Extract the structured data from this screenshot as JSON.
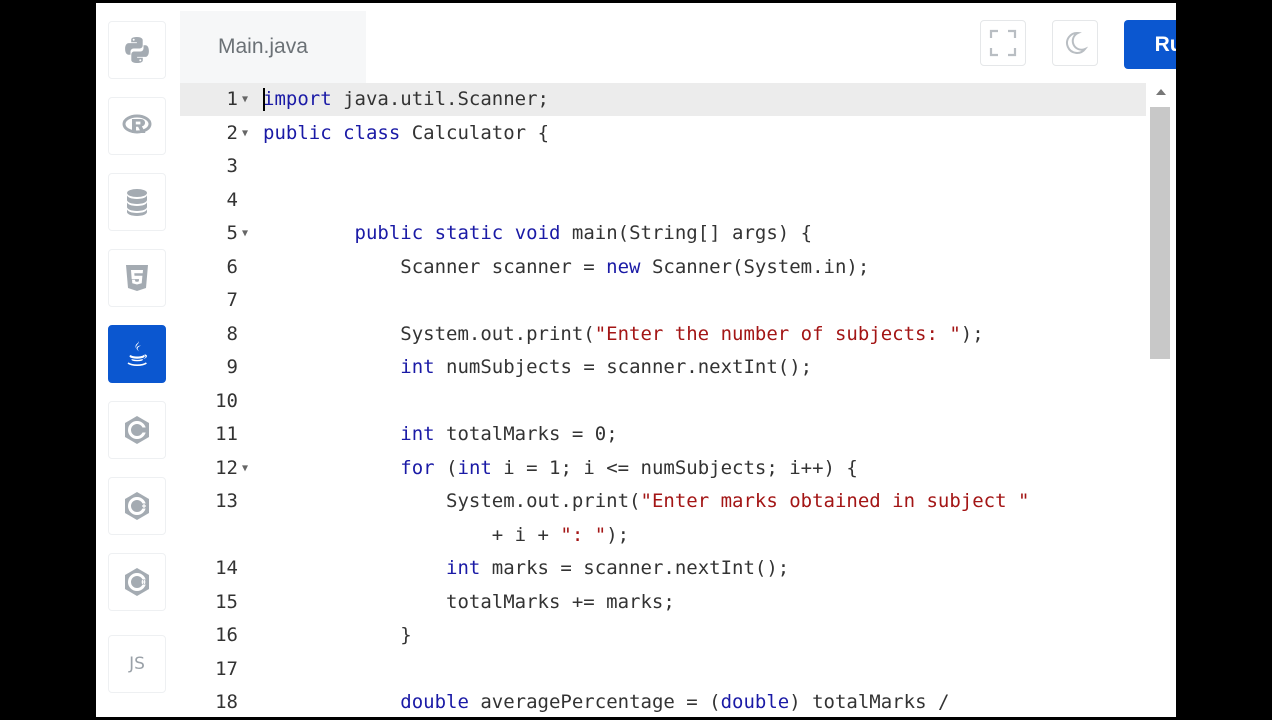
{
  "editor_tab": {
    "filename": "Main.java"
  },
  "header": {
    "run_label": "Run"
  },
  "sidebar": {
    "items": [
      {
        "icon": "python-icon"
      },
      {
        "icon": "r-icon"
      },
      {
        "icon": "sql-icon"
      },
      {
        "icon": "html5-icon"
      },
      {
        "icon": "java-icon",
        "active": true
      },
      {
        "icon": "c-icon"
      },
      {
        "icon": "cpp-icon"
      },
      {
        "icon": "csharp-icon"
      },
      {
        "icon": "javascript-icon",
        "label": "JS"
      }
    ]
  },
  "code": {
    "language": "java",
    "lines": [
      {
        "n": "1",
        "text": "import java.util.Scanner;"
      },
      {
        "n": "2",
        "text": "public class Calculator {"
      },
      {
        "n": "3",
        "text": ""
      },
      {
        "n": "4",
        "text": ""
      },
      {
        "n": "5",
        "text": "        public static void main(String[] args) {"
      },
      {
        "n": "6",
        "text": "            Scanner scanner = new Scanner(System.in);"
      },
      {
        "n": "7",
        "text": ""
      },
      {
        "n": "8",
        "text": "            System.out.print(\"Enter the number of subjects: \");"
      },
      {
        "n": "9",
        "text": "            int numSubjects = scanner.nextInt();"
      },
      {
        "n": "10",
        "text": ""
      },
      {
        "n": "11",
        "text": "            int totalMarks = 0;"
      },
      {
        "n": "12",
        "text": "            for (int i = 1; i <= numSubjects; i++) {"
      },
      {
        "n": "13",
        "text": "                System.out.print(\"Enter marks obtained in subject \""
      },
      {
        "n": "",
        "text": "                    + i + \": \");"
      },
      {
        "n": "14",
        "text": "                int marks = scanner.nextInt();"
      },
      {
        "n": "15",
        "text": "                totalMarks += marks;"
      },
      {
        "n": "16",
        "text": "            }"
      },
      {
        "n": "17",
        "text": ""
      },
      {
        "n": "18",
        "text": "            double averagePercentage = (double) totalMarks /"
      }
    ]
  },
  "colors": {
    "accent": "#0b57d0",
    "keyword": "#1a1aa6",
    "string": "#a31515"
  }
}
